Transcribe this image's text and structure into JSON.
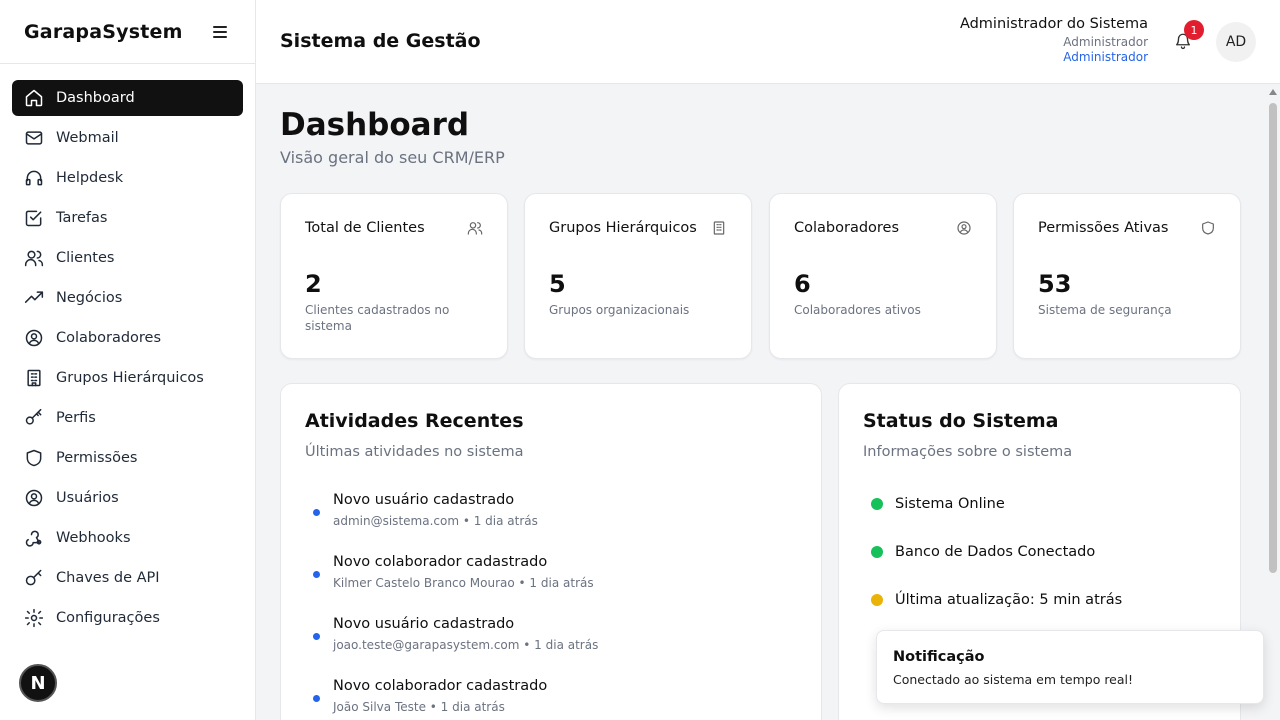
{
  "brand": {
    "name": "GarapaSystem"
  },
  "sidebar": {
    "items": [
      {
        "label": "Dashboard",
        "icon": "home-icon",
        "active": true
      },
      {
        "label": "Webmail",
        "icon": "mail-icon"
      },
      {
        "label": "Helpdesk",
        "icon": "headphones-icon"
      },
      {
        "label": "Tarefas",
        "icon": "checkbox-icon"
      },
      {
        "label": "Clientes",
        "icon": "users-icon"
      },
      {
        "label": "Negócios",
        "icon": "trending-up-icon"
      },
      {
        "label": "Colaboradores",
        "icon": "user-circle-icon"
      },
      {
        "label": "Grupos Hierárquicos",
        "icon": "building-icon"
      },
      {
        "label": "Perfis",
        "icon": "key-icon"
      },
      {
        "label": "Permissões",
        "icon": "shield-icon"
      },
      {
        "label": "Usuários",
        "icon": "user-circle-icon"
      },
      {
        "label": "Webhooks",
        "icon": "webhook-icon"
      },
      {
        "label": "Chaves de API",
        "icon": "key-icon"
      },
      {
        "label": "Configurações",
        "icon": "gear-icon"
      }
    ],
    "footer_badge": "N"
  },
  "header": {
    "title": "Sistema de Gestão",
    "user_name": "Administrador do Sistema",
    "user_role": "Administrador",
    "user_role_link": "Administrador",
    "notification_count": "1",
    "avatar_initials": "AD"
  },
  "page": {
    "title": "Dashboard",
    "subtitle": "Visão geral do seu CRM/ERP"
  },
  "stats": [
    {
      "label": "Total de Clientes",
      "value": "2",
      "desc": "Clientes cadastrados no sistema",
      "icon": "users-icon"
    },
    {
      "label": "Grupos Hierárquicos",
      "value": "5",
      "desc": "Grupos organizacionais",
      "icon": "building-icon"
    },
    {
      "label": "Colaboradores",
      "value": "6",
      "desc": "Colaboradores ativos",
      "icon": "user-circle-icon"
    },
    {
      "label": "Permissões Ativas",
      "value": "53",
      "desc": "Sistema de segurança",
      "icon": "shield-icon"
    }
  ],
  "activities": {
    "title": "Atividades Recentes",
    "subtitle": "Últimas atividades no sistema",
    "items": [
      {
        "title": "Novo usuário cadastrado",
        "meta": "admin@sistema.com • 1 dia atrás"
      },
      {
        "title": "Novo colaborador cadastrado",
        "meta": "Kilmer Castelo Branco Mourao • 1 dia atrás"
      },
      {
        "title": "Novo usuário cadastrado",
        "meta": "joao.teste@garapasystem.com • 1 dia atrás"
      },
      {
        "title": "Novo colaborador cadastrado",
        "meta": "João Silva Teste • 1 dia atrás"
      }
    ]
  },
  "system_status": {
    "title": "Status do Sistema",
    "subtitle": "Informações sobre o sistema",
    "items": [
      {
        "text": "Sistema Online",
        "color": "#16c15a"
      },
      {
        "text": "Banco de Dados Conectado",
        "color": "#16c15a"
      },
      {
        "text": "Última atualização: 5 min atrás",
        "color": "#eab308"
      }
    ]
  },
  "toast": {
    "title": "Notificação",
    "body": "Conectado ao sistema em tempo real!"
  }
}
